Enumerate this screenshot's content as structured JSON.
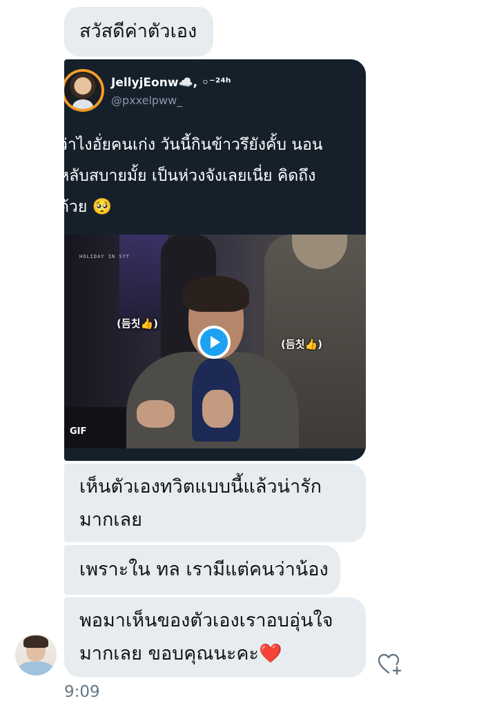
{
  "messages": {
    "m1": "สวัสดีค่าตัวเอง",
    "m2": [
      "เห็นตัวเองทวิตแบบนี้แล้วน่ารัก",
      "มากเลย"
    ],
    "m3": "เพราะใน ทล เรามีแต่คนว่าน้อง",
    "m4": [
      "พอมาเห็นของตัวเองเราอบอุ่นใจ",
      "มากเลย ขอบคุณนะคะ"
    ],
    "m4_emoji": "❤️"
  },
  "tweet": {
    "author_name": "JellyjEonw☁️, ◦⁻²⁴ʰ",
    "handle": "@pxxelpww_",
    "text_lines": [
      "ว่าไงอั่ยคนเก่ง วันนี้กินข้าวรึยังคั้บ นอน",
      "หลับสบายมั้ย เป็นห่วงจังเลยเนี่ย คิดถึง",
      "ด้วย 🥺"
    ],
    "media": {
      "badge": "GIF",
      "caption_left": "(듬칫👍)",
      "caption_right": "(듬칫👍)",
      "watermark": "HOLIDAY IN SYT"
    }
  },
  "timestamp": "9:09",
  "icons": {
    "like": "heart-plus-icon",
    "play": "play-icon"
  },
  "colors": {
    "bubble": "#e6ecf0",
    "card": "#15202b",
    "accent": "#1da1f2",
    "heart": "#e0245e"
  }
}
